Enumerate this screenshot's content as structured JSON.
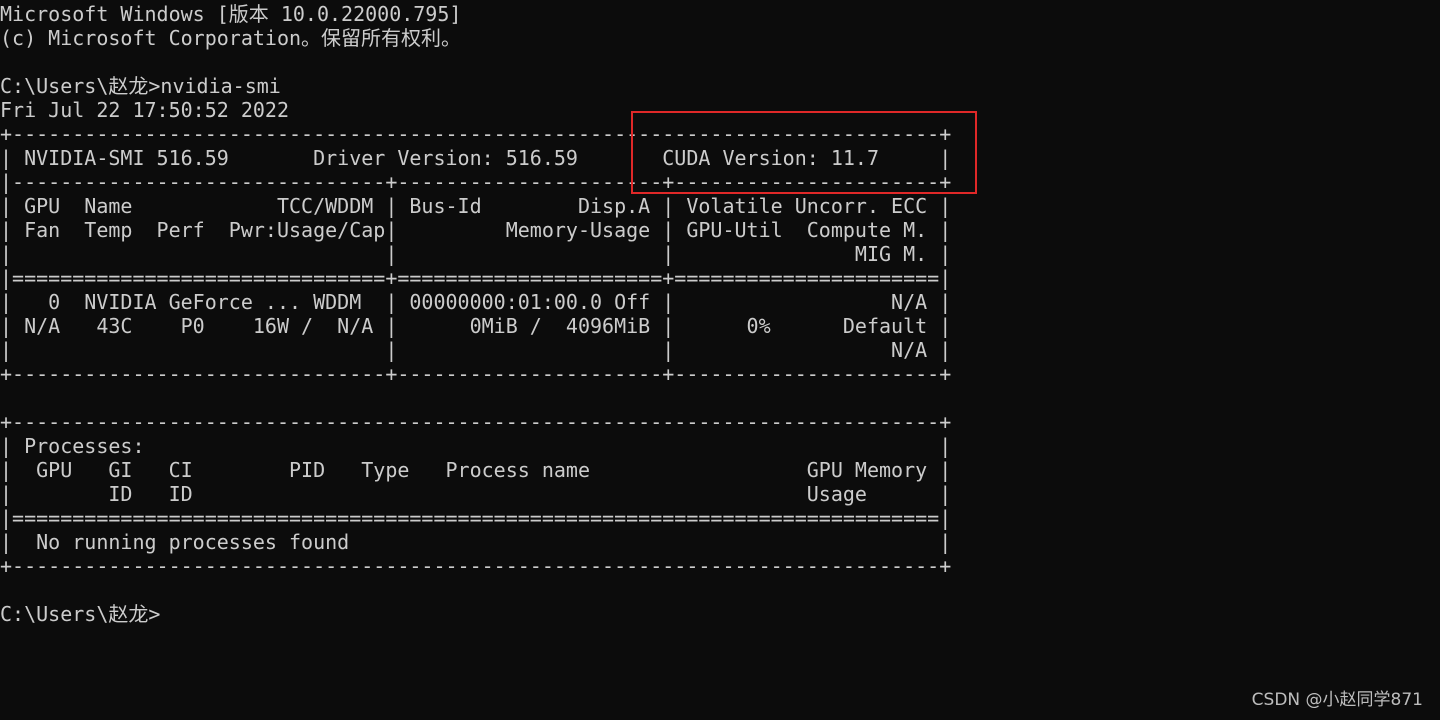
{
  "terminal": {
    "lines": [
      "Microsoft Windows [版本 10.0.22000.795]",
      "(c) Microsoft Corporation。保留所有权利。",
      "",
      "C:\\Users\\赵龙>nvidia-smi",
      "Fri Jul 22 17:50:52 2022",
      "+-----------------------------------------------------------------------------+",
      "| NVIDIA-SMI 516.59       Driver Version: 516.59       CUDA Version: 11.7     |",
      "|-------------------------------+----------------------+----------------------+",
      "| GPU  Name            TCC/WDDM | Bus-Id        Disp.A | Volatile Uncorr. ECC |",
      "| Fan  Temp  Perf  Pwr:Usage/Cap|         Memory-Usage | GPU-Util  Compute M. |",
      "|                               |                      |               MIG M. |",
      "|===============================+======================+======================|",
      "|   0  NVIDIA GeForce ... WDDM  | 00000000:01:00.0 Off |                  N/A |",
      "| N/A   43C    P0    16W /  N/A |      0MiB /  4096MiB |      0%      Default |",
      "|                               |                      |                  N/A |",
      "+-------------------------------+----------------------+----------------------+",
      "",
      "+-----------------------------------------------------------------------------+",
      "| Processes:                                                                  |",
      "|  GPU   GI   CI        PID   Type   Process name                  GPU Memory |",
      "|        ID   ID                                                   Usage      |",
      "|=============================================================================|",
      "|  No running processes found                                                 |",
      "+-----------------------------------------------------------------------------+",
      "",
      "C:\\Users\\赵龙>"
    ]
  },
  "watermark": {
    "text": "CSDN @小赵同学871"
  },
  "colors": {
    "background": "#0c0c0c",
    "text": "#cccccc",
    "highlight": "#e02828"
  }
}
